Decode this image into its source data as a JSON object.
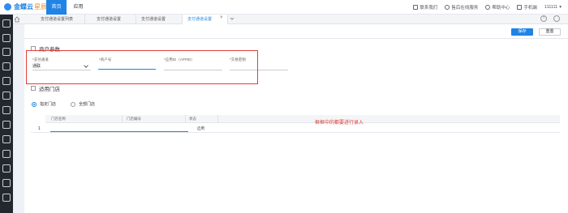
{
  "app": {
    "logo_text": "金蝶云",
    "logo_sub": "星辰",
    "nav": [
      "首页",
      "应用"
    ],
    "top_links": [
      "联系我们",
      "售后在线服务",
      "帮助中心",
      "手机端",
      "111111"
    ]
  },
  "tabs": [
    {
      "label": "支付通道设置列表",
      "active": false
    },
    {
      "label": "支付通道设置",
      "active": false
    },
    {
      "label": "支付通道设置",
      "active": false
    },
    {
      "label": "支付通道设置",
      "active": true
    }
  ],
  "toolbar": {
    "save_label": "保存",
    "reset_label": "重置"
  },
  "merchant": {
    "section_title": "商户参数",
    "fields": [
      {
        "label": "*支付通道",
        "value": "通联"
      },
      {
        "label": "*商户号",
        "value": ""
      },
      {
        "label": "*应用ID（APPID）",
        "value": ""
      },
      {
        "label": "*交易密钥",
        "value": ""
      }
    ]
  },
  "stores": {
    "section_title": "适用门店",
    "radio_options": [
      {
        "label": "指定门店",
        "selected": true
      },
      {
        "label": "全部门店",
        "selected": false
      }
    ],
    "columns": [
      "门店名称",
      "门店编号",
      "状态"
    ],
    "rows": [
      {
        "index": "1",
        "name": "",
        "code": "",
        "status": "启用"
      }
    ]
  },
  "annotation": "框框中的都要进行录入",
  "colors": {
    "primary": "#1f84e5",
    "annotation": "#e0403b",
    "sidebar": "#23282f"
  }
}
